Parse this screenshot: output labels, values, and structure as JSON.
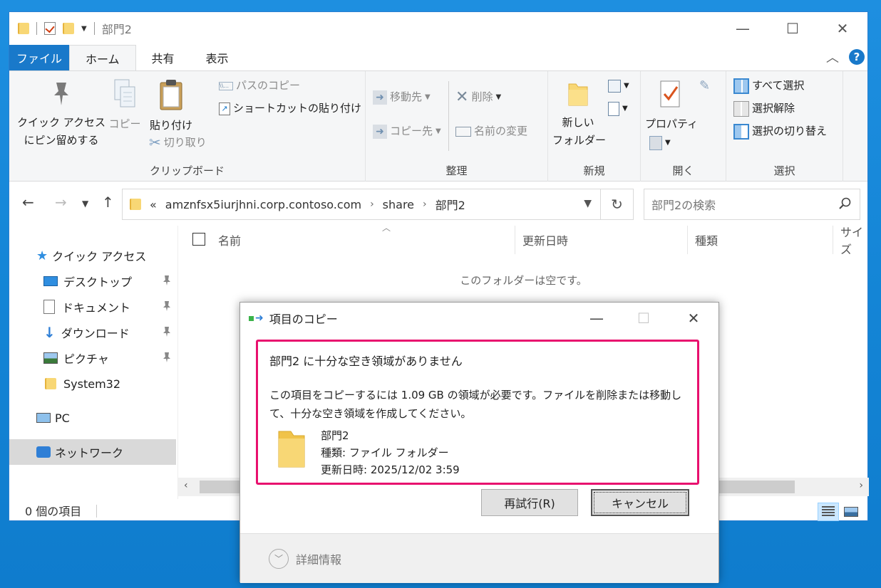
{
  "window": {
    "title": "部門2",
    "minimize": "—",
    "maximize": "☐",
    "close": "✕"
  },
  "ribbon_tabs": [
    {
      "label": "ファイル"
    },
    {
      "label": "ホーム"
    },
    {
      "label": "共有"
    },
    {
      "label": "表示"
    }
  ],
  "help_label": "?",
  "ribbon": {
    "clipboard": {
      "pin_label_1": "クイック アクセス",
      "pin_label_2": "にピン留めする",
      "copy": "コピー",
      "paste": "貼り付け",
      "cut": "切り取り",
      "copy_path": "パスのコピー",
      "paste_shortcut": "ショートカットの貼り付け",
      "group": "クリップボード"
    },
    "organize": {
      "move_to": "移動先",
      "copy_to": "コピー先",
      "delete": "削除",
      "rename": "名前の変更",
      "group": "整理"
    },
    "new": {
      "new_folder_1": "新しい",
      "new_folder_2": "フォルダー",
      "group": "新規"
    },
    "open": {
      "properties": "プロパティ",
      "group": "開く"
    },
    "select": {
      "select_all": "すべて選択",
      "select_none": "選択解除",
      "invert": "選択の切り替え",
      "group": "選択"
    }
  },
  "address": {
    "overflow": "«",
    "crumbs": [
      "amznfsx5iurjhni.corp.contoso.com",
      "share",
      "部門2"
    ],
    "search_placeholder": "部門2の検索"
  },
  "nav_pane": {
    "quick_access": "クイック アクセス",
    "items": [
      {
        "label": "デスクトップ"
      },
      {
        "label": "ドキュメント"
      },
      {
        "label": "ダウンロード"
      },
      {
        "label": "ピクチャ"
      },
      {
        "label": "System32"
      }
    ],
    "pc": "PC",
    "network": "ネットワーク"
  },
  "columns": [
    "名前",
    "更新日時",
    "種類",
    "サイズ"
  ],
  "empty_message": "このフォルダーは空です。",
  "status": {
    "count": "0 個の項目"
  },
  "dialog": {
    "title": "項目のコピー",
    "heading": "部門2 に十分な空き領域がありません",
    "body": "この項目をコピーするには 1.09 GB の領域が必要です。ファイルを削除または移動して、十分な空き領域を作成してください。",
    "file_name": "部門2",
    "file_type": "種類: ファイル フォルダー",
    "file_modified": "更新日時: 2025/12/02 3:59",
    "retry": "再試行(R)",
    "cancel": "キャンセル",
    "details": "詳細情報"
  },
  "colors": {
    "accent": "#1979ca",
    "highlight_border": "#e8106e",
    "folder": "#f8d775"
  }
}
